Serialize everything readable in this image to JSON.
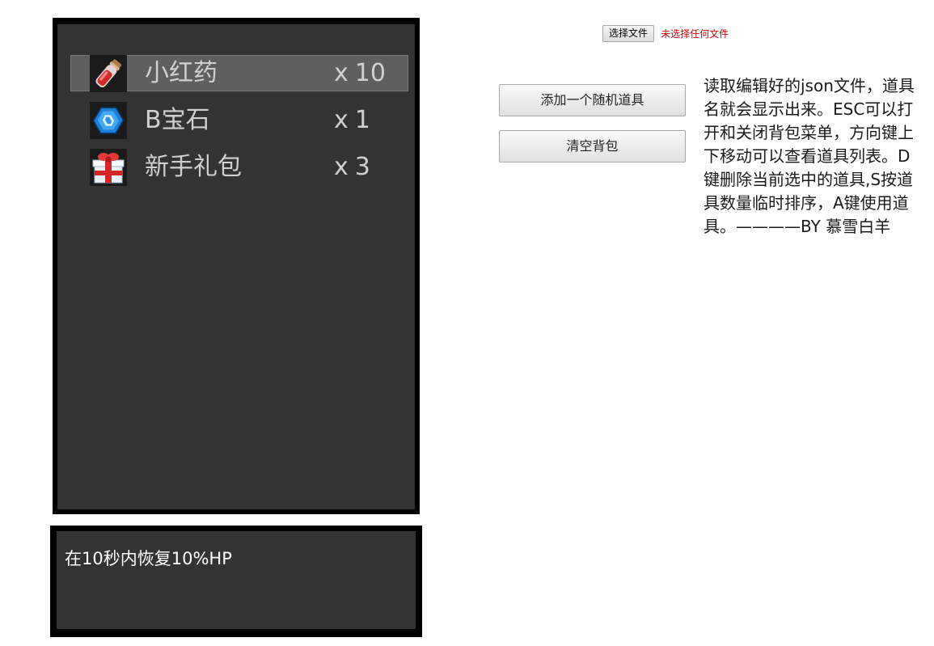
{
  "file_chooser": {
    "button_label": "选择文件",
    "status_text": "未选择任何文件"
  },
  "buttons": {
    "add_random": "添加一个随机道具",
    "clear_bag": "清空背包"
  },
  "instructions": "读取编辑好的json文件，道具名就会显示出来。ESC可以打开和关闭背包菜单，方向键上下移动可以查看道具列表。D键删除当前选中的道具,S按道具数量临时排序，A键使用道具。————BY 慕雪白羊",
  "inventory": {
    "selected_index": 0,
    "qty_prefix": "x",
    "items": [
      {
        "name": "小红药",
        "count": "10",
        "icon": "red-potion-icon"
      },
      {
        "name": "B宝石",
        "count": "1",
        "icon": "blue-gem-icon"
      },
      {
        "name": "新手礼包",
        "count": "3",
        "icon": "gift-box-icon"
      }
    ]
  },
  "description": {
    "text": "在10秒内恢复10%HP"
  },
  "colors": {
    "panel_bg": "#333333",
    "panel_border": "#000000",
    "selected_row": "#5f5f5f",
    "item_text": "#d0d0d0",
    "file_status": "#cc0000"
  }
}
